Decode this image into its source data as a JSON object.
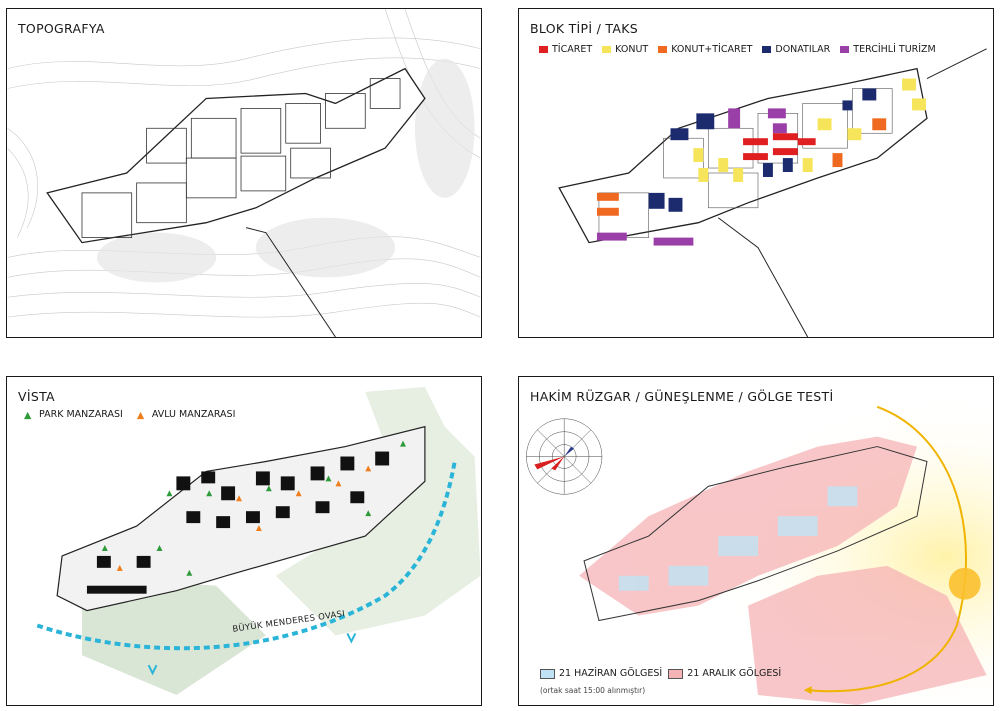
{
  "panels": {
    "topography": {
      "title": "TOPOGRAFYA"
    },
    "block_type": {
      "title": "BLOK TİPİ / TAKS",
      "legend": [
        {
          "label": "TİCARET",
          "color": "#e02020"
        },
        {
          "label": "KONUT",
          "color": "#f6e55a"
        },
        {
          "label": "KONUT+TİCARET",
          "color": "#ef6a20"
        },
        {
          "label": "DONATILAR",
          "color": "#1c2a6e"
        },
        {
          "label": "TERCİHLİ TURİZM",
          "color": "#9b3fa8"
        }
      ]
    },
    "vista": {
      "title": "VİSTA",
      "legend": [
        {
          "label": "PARK MANZARASI",
          "color": "#2e9a3a",
          "icon": "green-arrow-icon"
        },
        {
          "label": "AVLU MANZARASI",
          "color": "#ef7e1e",
          "icon": "orange-arrow-icon"
        }
      ],
      "valley_label": "BÜYÜK MENDERES OVASI"
    },
    "wind_sun": {
      "title": "HAKİM RÜZGAR / GÜNEŞLENME / GÖLGE TESTİ",
      "legend": [
        {
          "label": "21 HAZİRAN GÖLGESİ",
          "color": "#bfe3f5"
        },
        {
          "label": "21 ARALIK GÖLGESİ",
          "color": "#f6b3b5"
        }
      ],
      "note": "(ortak saat 15:00 alınmıştır)"
    }
  }
}
